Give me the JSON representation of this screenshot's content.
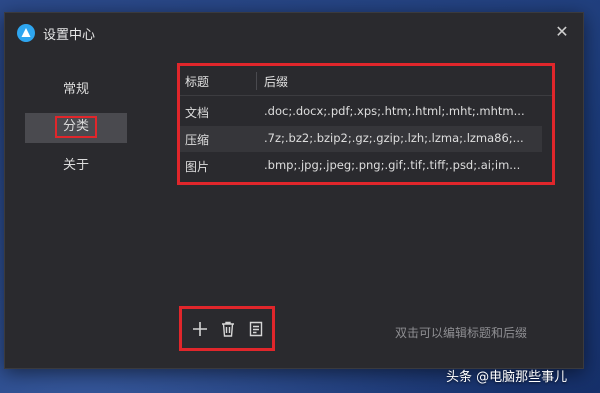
{
  "window": {
    "title": "设置中心",
    "close_glyph": "✕",
    "icon": "app-logo-icon"
  },
  "sidebar": {
    "items": [
      {
        "label": "常规",
        "selected": false
      },
      {
        "label": "分类",
        "selected": true
      },
      {
        "label": "关于",
        "selected": false
      }
    ]
  },
  "table": {
    "columns": [
      "标题",
      "后缀"
    ],
    "rows": [
      {
        "title": "文档",
        "ext": ".doc;.docx;.pdf;.xps;.htm;.html;.mht;.mhtm...",
        "selected": false
      },
      {
        "title": "压缩",
        "ext": ".7z;.bz2;.bzip2;.gz;.gzip;.lzh;.lzma;.lzma86;...",
        "selected": true
      },
      {
        "title": "图片",
        "ext": ".bmp;.jpg;.jpeg;.png;.gif;.tif;.tiff;.psd;.ai;im...",
        "selected": false
      }
    ]
  },
  "toolbar": {
    "add_icon": "plus-icon",
    "delete_icon": "trash-icon",
    "edit_icon": "edit-icon"
  },
  "hint": "双击可以编辑标题和后缀",
  "watermark": "头条 @电脑那些事儿",
  "colors": {
    "window_bg": "#2a2a2e",
    "highlight_border": "#e0262b",
    "app_icon": "#2ea6f0",
    "selected_row": "#36363a",
    "selected_nav": "#4a4a4f"
  }
}
